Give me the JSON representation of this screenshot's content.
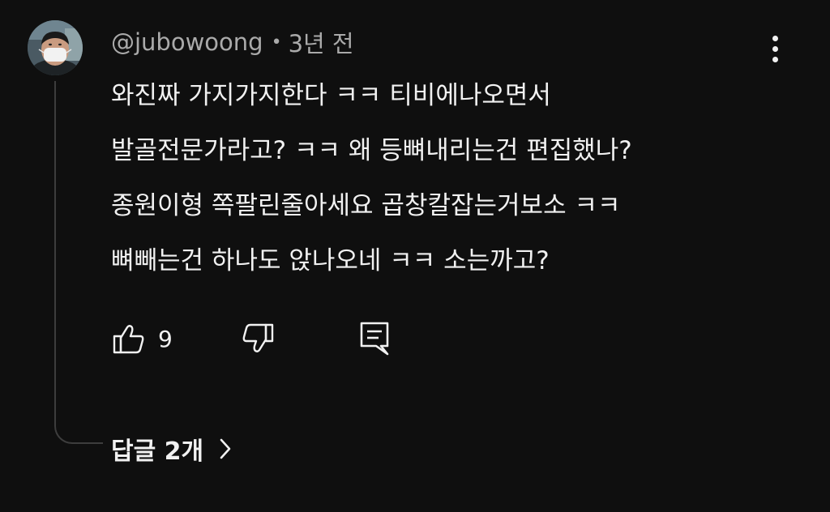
{
  "comment": {
    "author": "@jubowoong",
    "separator": "•",
    "timestamp": "3년 전",
    "lines": [
      "와진짜 가지가지한다 ㅋㅋ 티비에나오면서",
      "발골전문가라고? ㅋㅋ 왜 등뼈내리는건 편집했나?",
      "종원이형 쪽팔린줄아세요 곱창칼잡는거보소 ㅋㅋ",
      "뼈빼는건 하나도 앉나오네 ㅋㅋ 소는까고?"
    ],
    "like_count": "9"
  },
  "replies": {
    "label": "답글 2개"
  },
  "icons": {
    "more": "more-vertical-icon",
    "like": "thumb-up-icon",
    "dislike": "thumb-down-icon",
    "reply": "comment-icon",
    "chevron": "chevron-right-icon"
  },
  "colors": {
    "background": "#0f0f0f",
    "text_primary": "#f1f1f1",
    "text_secondary": "#aaaaaa",
    "thread_line": "#3d3d3d"
  }
}
